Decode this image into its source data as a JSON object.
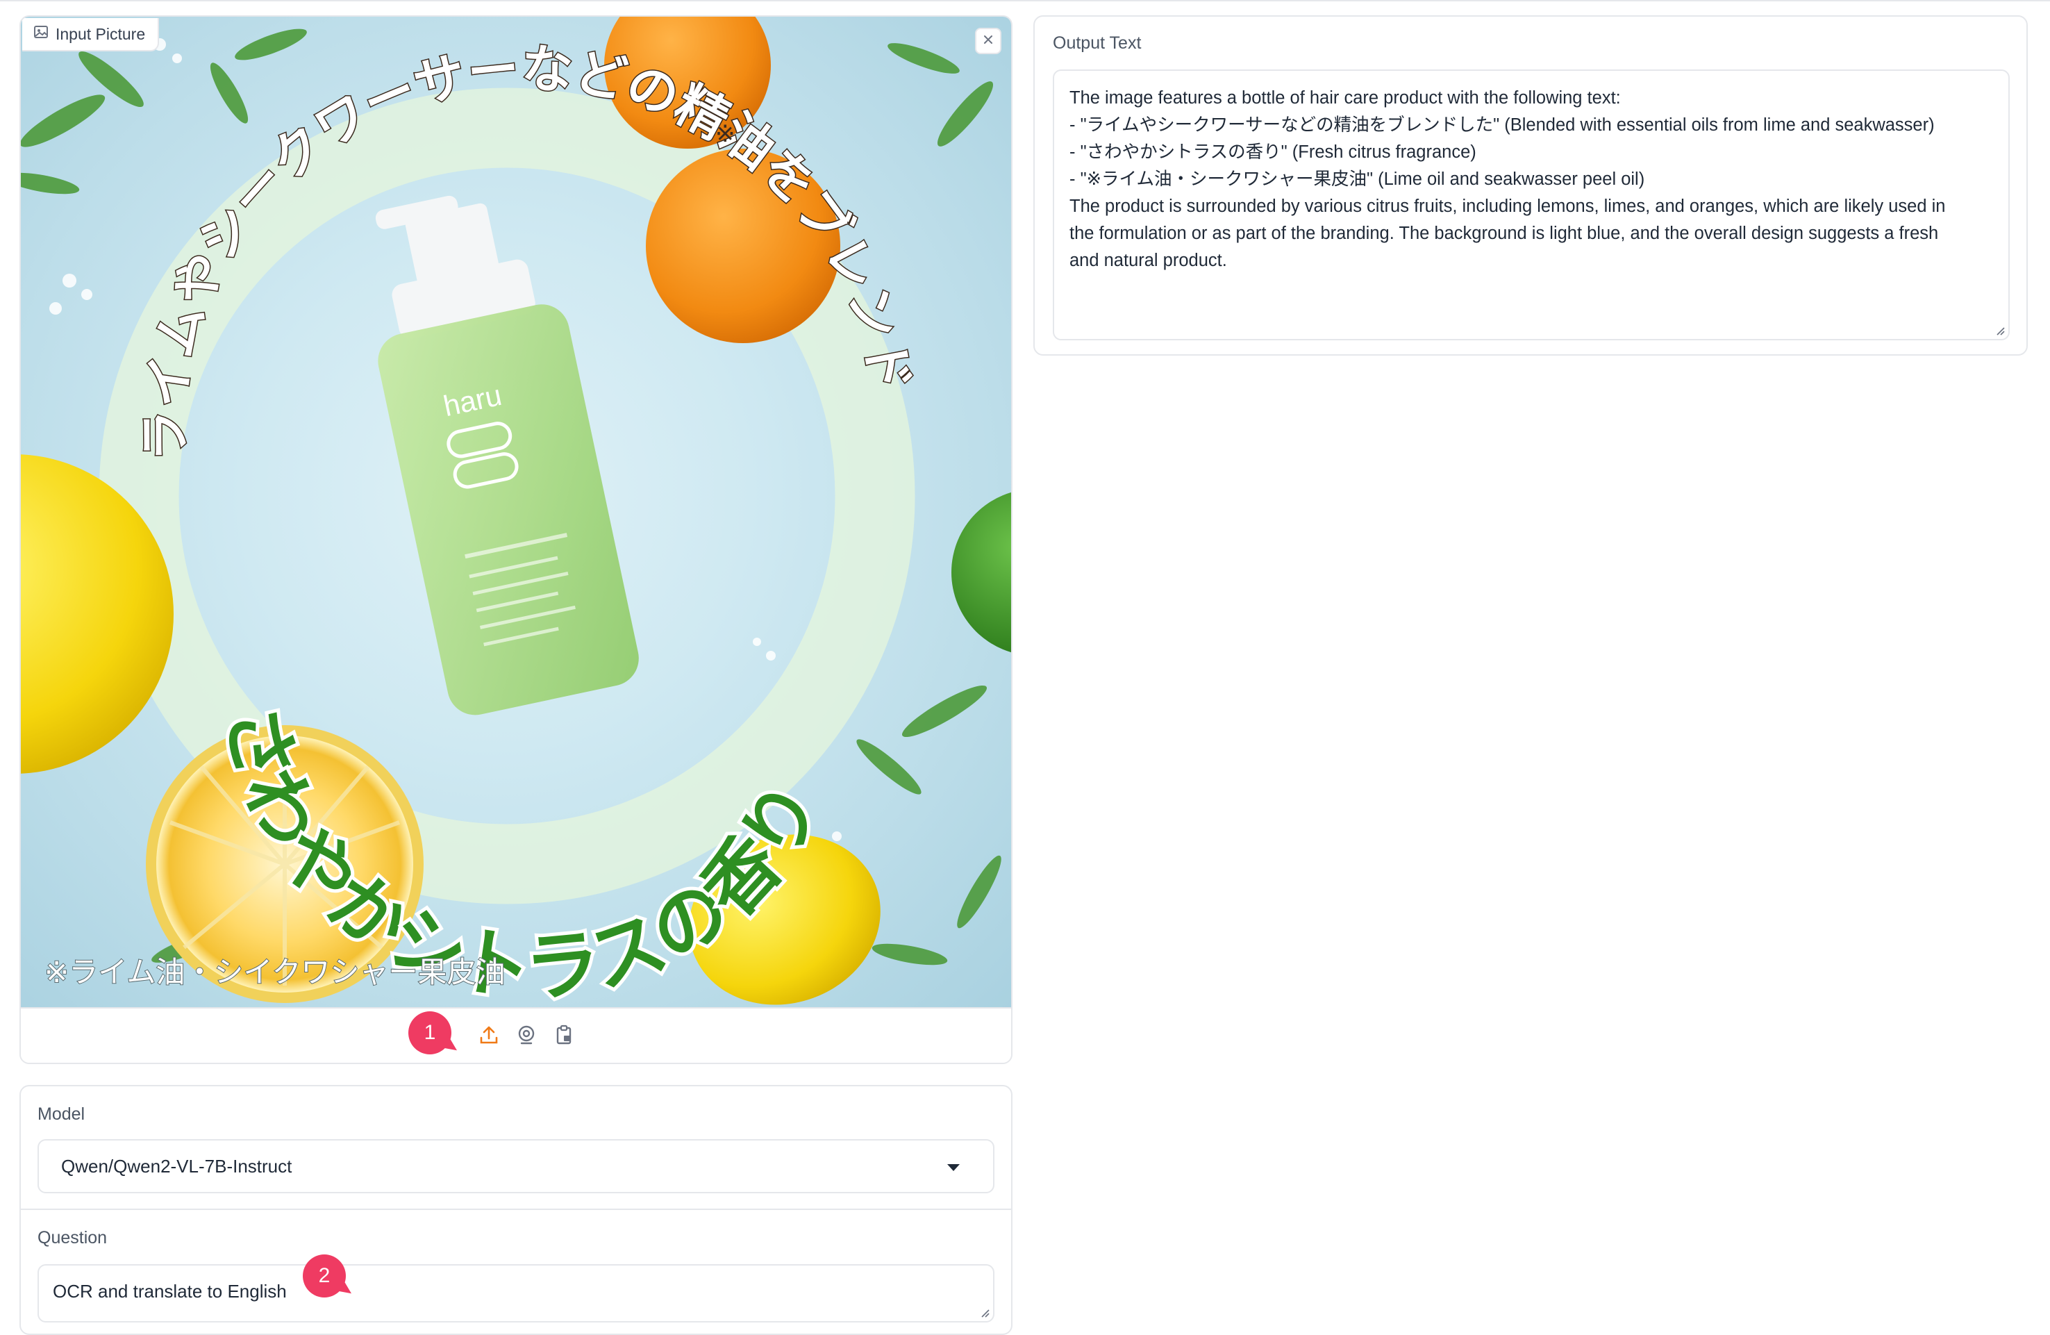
{
  "input_image": {
    "chip_label": "Input Picture",
    "overlay_text_arc_top": "ライムやシークワーサーなどの精油をブレンドした",
    "overlay_asterisk": "※",
    "overlay_text_arc_bottom": "さわやかシトラスの香り",
    "overlay_footnote": "※ライム油・シイクワシャー果皮油",
    "bottle_brand": "haru",
    "tools": [
      "upload-icon",
      "webcam-icon",
      "clipboard-icon"
    ]
  },
  "markers": [
    "1",
    "2"
  ],
  "model": {
    "label": "Model",
    "selected": "Qwen/Qwen2-VL-7B-Instruct"
  },
  "question": {
    "label": "Question",
    "value": "OCR and translate to English"
  },
  "output": {
    "label": "Output Text",
    "lines": [
      "The image features a bottle of hair care product with the following text:",
      "",
      "- \"ライムやシークワーサーなどの精油をブレンドした\" (Blended with essential oils from lime and seakwasser)",
      "- \"さわやかシトラスの香り\" (Fresh citrus fragrance)",
      "- \"※ライム油・シークワシャー果皮油\" (Lime oil and seakwasser peel oil)",
      "",
      "The product is surrounded by various citrus fruits, including lemons, limes, and oranges, which are likely used in",
      "the formulation or as part of the branding. The background is light blue, and the overall design suggests a fresh",
      "and natural product."
    ]
  }
}
